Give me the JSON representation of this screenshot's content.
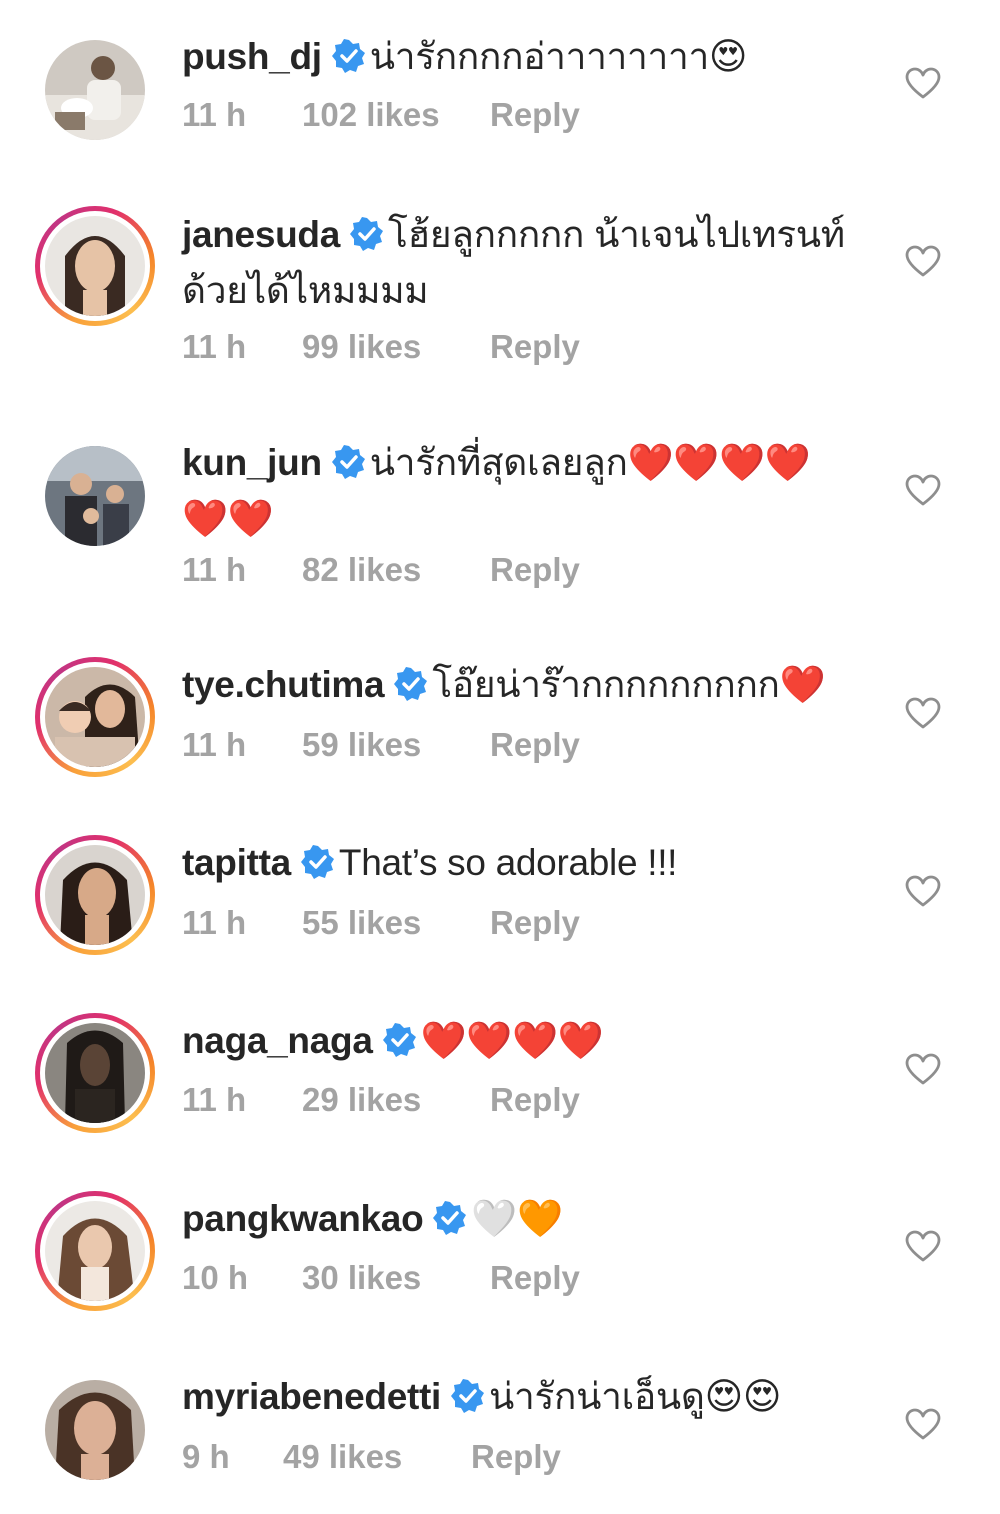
{
  "accent": {
    "verified": "#3897f0",
    "meta_text": "#a3a3a3"
  },
  "comments": [
    {
      "avatar": "photo-man-cooking",
      "username": "push_dj",
      "text": "น่ารักกกกอ่าาาาาาาา😍",
      "time": "11 h",
      "likes": "102 likes",
      "reply": "Reply",
      "has_story_ring": false
    },
    {
      "avatar": "photo-woman-portrait",
      "username": "janesuda",
      "text": "โฮ้ยลูกกกกก น้าเจนไปเทรนท์",
      "text_line2": "ด้วยได้ไหมมมม",
      "time": "11 h",
      "likes": "99 likes",
      "reply": "Reply",
      "has_story_ring": true
    },
    {
      "avatar": "photo-family",
      "username": "kun_jun",
      "text": "น่ารักที่สุดเลยลูก❤️❤️❤️❤️",
      "text_line2": "❤️❤️",
      "time": "11 h",
      "likes": "82 likes",
      "reply": "Reply",
      "has_story_ring": false
    },
    {
      "avatar": "photo-mother-child",
      "username": "tye.chutima",
      "text": "โอ๊ยน่าร๊ากกกกกกกกก❤️",
      "time": "11 h",
      "likes": "59 likes",
      "reply": "Reply",
      "has_story_ring": true
    },
    {
      "avatar": "photo-woman-dark-hair",
      "username": "tapitta",
      "text": "That’s so adorable !!!",
      "time": "11 h",
      "likes": "55 likes",
      "reply": "Reply",
      "has_story_ring": true
    },
    {
      "avatar": "photo-man-long-hair",
      "username": "naga_naga",
      "text": "❤️❤️❤️❤️",
      "time": "11 h",
      "likes": "29 likes",
      "reply": "Reply",
      "has_story_ring": true
    },
    {
      "avatar": "photo-woman-wavy-hair",
      "username": "pangkwankao",
      "text": "🤍🧡",
      "time": "10 h",
      "likes": "30 likes",
      "reply": "Reply",
      "has_story_ring": true
    },
    {
      "avatar": "photo-woman-closeup",
      "username": "myriabenedetti",
      "text": "น่ารักน่าเอ็นดู😍😍",
      "time": "9 h",
      "likes": "49 likes",
      "reply": "Reply",
      "has_story_ring": false
    }
  ]
}
